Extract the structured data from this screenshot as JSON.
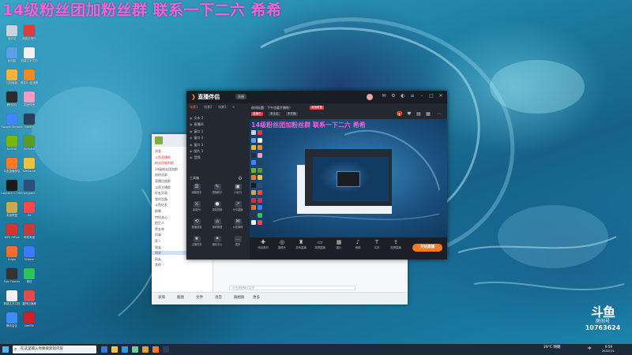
{
  "overlay_title": "14级粉丝团加粉丝群 联系一下二六 希希",
  "desktop": {
    "icons": [
      {
        "label": "回收站",
        "color": "#c9d4e0"
      },
      {
        "label": "网易云音乐",
        "color": "#e23b3b"
      },
      {
        "label": "此电脑",
        "color": "#5aa0e6"
      },
      {
        "label": "新建文本文档",
        "color": "#f2f2f2"
      },
      {
        "label": "控制面板",
        "color": "#f1b33c"
      },
      {
        "label": "网易UU加速器",
        "color": "#f08a24"
      },
      {
        "label": "腾讯QQ",
        "color": "#2b2b2b"
      },
      {
        "label": "哔哩哔哩",
        "color": "#f59ac0"
      },
      {
        "label": "Google Chrome",
        "color": "#4285f4"
      },
      {
        "label": "Steam",
        "color": "#2a3f5a"
      },
      {
        "label": "NVIDIA",
        "color": "#76b900"
      },
      {
        "label": "GeForce",
        "color": "#5b9a23"
      },
      {
        "label": "斗鱼直播伴侣",
        "color": "#ff7a22"
      },
      {
        "label": "WeGame",
        "color": "#f0c040"
      },
      {
        "label": "Logitech G HUB",
        "color": "#1a1a1a"
      },
      {
        "label": "wegame",
        "color": "#2d4f7a"
      },
      {
        "label": "英雄联盟",
        "color": "#c9a94e"
      },
      {
        "label": "EA",
        "color": "#ff4747"
      },
      {
        "label": "WPS Office",
        "color": "#d9312b"
      },
      {
        "label": "网易有道",
        "color": "#c93a3a"
      },
      {
        "label": "Origin",
        "color": "#f56c2d"
      },
      {
        "label": "ToDesk",
        "color": "#3d7af5"
      },
      {
        "label": "Epic Games",
        "color": "#333333"
      },
      {
        "label": "微信",
        "color": "#2ec25b"
      },
      {
        "label": "新建文本文档",
        "color": "#f2f2f2"
      },
      {
        "label": "雷神加速器",
        "color": "#e34a4a"
      },
      {
        "label": "腾讯会议",
        "color": "#3f8cf0"
      },
      {
        "label": "Netflix",
        "color": "#d11f29"
      }
    ]
  },
  "obs": {
    "app_name": "直播伴侣",
    "badge": "直播",
    "tabs": [
      "场景1",
      "场景2",
      "场景3",
      "+"
    ],
    "scenes": [
      "文本 2",
      "直播间",
      "窗口 1",
      "窗口 2",
      "窗口 3",
      "图片 1",
      "音频"
    ],
    "tools_heading": "工具箱",
    "tools": [
      "弹幕助手",
      "直播助手",
      "小窗口",
      "连麦PK",
      "录制视频",
      "分享直播",
      "直播回放",
      "房间管理",
      "公告管理",
      "主播任务",
      "福利中心",
      "更多"
    ],
    "stream_info": {
      "title_line": "房间标题：下午也要开播啦！",
      "category_tag": "英雄联盟",
      "tags": [
        "直播中",
        "未认证",
        "未开播"
      ]
    },
    "bottom_tools": [
      "添加素材",
      "摄像头",
      "游戏直播",
      "录屏直播",
      "图片",
      "音频",
      "文本",
      "投屏直播"
    ],
    "live_button": "开始直播"
  },
  "chat": {
    "sidebar_lines": [
      "消息",
      "斗鱼直播群",
      "粉丝团福利群",
      "14级粉丝团加群",
      "加粉丝群",
      "直播回放群",
      "斗鱼主播群",
      "好友列表",
      "我的设备",
      "斗鱼好友",
      "群聊",
      "特别关心",
      "陌生人",
      "黑名单",
      "同事",
      "家人",
      "朋友",
      "同学",
      "网友",
      "其他"
    ],
    "input_placeholder": "点击此处输入文字",
    "bottom_items": [
      "表情",
      "截图",
      "文件",
      "语音",
      "群相册",
      "更多"
    ]
  },
  "douyu": {
    "mark": "斗鱼",
    "sub": "房间号",
    "room": "10763624"
  },
  "taskbar": {
    "search_placeholder": "在这里输入你要搜索的内容",
    "app_colors": [
      "#3a7bd5",
      "#f9c440",
      "#2d9cdb",
      "#6fcf97",
      "#e0a23b",
      "#ff7a22",
      "#2a3f5a"
    ],
    "tray_weather": "29°C 晴朗",
    "tray_lang": "中",
    "tray_time": "9:59",
    "tray_date": "2022/7/1"
  }
}
